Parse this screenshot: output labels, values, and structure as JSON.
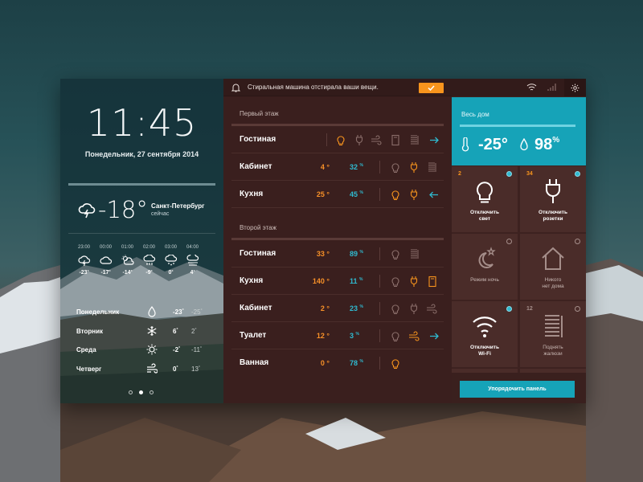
{
  "colors": {
    "accent_orange": "#f7941d",
    "accent_cyan": "#16a3b8",
    "panel_brown": "#3a1f1e"
  },
  "weather": {
    "time": "11:45",
    "date": "Понедельник, 27 сентября 2014",
    "current_temp": "-18°",
    "city": "Санкт-Петербург",
    "city_sub": "сейчас",
    "hourly": [
      {
        "time": "23:00",
        "icon": "thunder-cloud-icon",
        "temp": "-23"
      },
      {
        "time": "00:00",
        "icon": "cloud-icon",
        "temp": "-17"
      },
      {
        "time": "01:00",
        "icon": "sun-cloud-icon",
        "temp": "-14"
      },
      {
        "time": "02:00",
        "icon": "rain-cloud-icon",
        "temp": "-9"
      },
      {
        "time": "03:00",
        "icon": "snow-cloud-icon",
        "temp": "0"
      },
      {
        "time": "04:00",
        "icon": "fog-cloud-icon",
        "temp": "4"
      }
    ],
    "daily": [
      {
        "day": "Понедельник",
        "icon": "drop-icon",
        "hi": "-23",
        "lo": "-25"
      },
      {
        "day": "Вторник",
        "icon": "snowflake-icon",
        "hi": "6",
        "lo": "2"
      },
      {
        "day": "Среда",
        "icon": "sun-icon",
        "hi": "-2",
        "lo": "-11"
      },
      {
        "day": "Четверг",
        "icon": "wind-icon",
        "hi": "0",
        "lo": "13"
      }
    ]
  },
  "notification": {
    "text": "Стиральная машина отстирала ваши вещи.",
    "ok_icon": "check-icon"
  },
  "floors": [
    {
      "title": "Первый этаж",
      "rooms": [
        {
          "name": "Гостиная",
          "temp": "",
          "hum": ""
        },
        {
          "name": "Кабинет",
          "temp": "4",
          "hum": "32"
        },
        {
          "name": "Кухня",
          "temp": "25",
          "hum": "45"
        }
      ]
    },
    {
      "title": "Второй этаж",
      "rooms": [
        {
          "name": "Гостиная",
          "temp": "33",
          "hum": "89"
        },
        {
          "name": "Кухня",
          "temp": "140",
          "hum": "11"
        },
        {
          "name": "Кабинет",
          "temp": "2",
          "hum": "23"
        },
        {
          "name": "Туалет",
          "temp": "12",
          "hum": "3"
        },
        {
          "name": "Ванная",
          "temp": "0",
          "hum": "78"
        }
      ]
    }
  ],
  "degree_symbol": "°",
  "percent_symbol": "%",
  "house": {
    "title": "Весь дом",
    "temp": "-25°",
    "hum": "98",
    "hum_unit": "%"
  },
  "tiles": [
    {
      "count": "2",
      "label": "Отключить свет",
      "label2": "",
      "icon": "bulb-icon",
      "active": true
    },
    {
      "count": "34",
      "label": "Отключить розетки",
      "label2": "",
      "icon": "plug-icon",
      "active": true
    },
    {
      "count": "",
      "label": "Режим ночь",
      "label2": "",
      "icon": "moon-icon",
      "active": false
    },
    {
      "count": "",
      "label": "Никого",
      "label2": "нет дома",
      "icon": "house-icon",
      "active": false
    },
    {
      "count": "",
      "label": "Отключить",
      "label2": "Wi-Fi",
      "icon": "wifi-icon",
      "active": true
    },
    {
      "count": "12",
      "label": "Поднять",
      "label2": "жалюзи",
      "icon": "blinds-icon",
      "active": false
    }
  ],
  "sort_button": "Упорядочить панель"
}
